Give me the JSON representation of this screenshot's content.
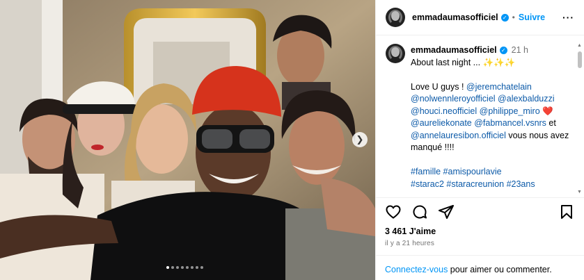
{
  "header": {
    "username": "emmadaumasofficiel",
    "verified_icon": "verified-badge-icon",
    "separator": "•",
    "follow_label": "Suivre",
    "more_icon": "more-options-icon"
  },
  "caption": {
    "username": "emmadaumasofficiel",
    "time": "21 h",
    "line1": "About last night ... ✨✨✨",
    "love_prefix": "Love U guys ! ",
    "mentions": [
      "@jeremchatelain",
      "@nolwennleroyofficiel",
      "@alexbalduzzi",
      "@houci.neofficiel",
      "@philippe_miro",
      "@aureliekonate",
      "@fabmancel.vsnrs",
      "@annelauresibon.officiel"
    ],
    "heart_emoji": "❤️",
    "et": " et ",
    "suffix": " vous nous avez manqué !!!!",
    "hashtags_line1": "#famille #amispourlavie",
    "hashtags_line2": "#starac2 #staracreunion #23ans"
  },
  "actions": {
    "like_icon": "heart-icon",
    "comment_icon": "comment-icon",
    "share_icon": "share-icon",
    "save_icon": "bookmark-icon",
    "likes_text": "3 461 J'aime",
    "posted_ago": "il y a 21 heures"
  },
  "login": {
    "link": "Connectez-vous",
    "text": " pour aimer ou commenter."
  },
  "carousel": {
    "dots": 8,
    "active_index": 0,
    "next_icon": "chevron-right-icon"
  }
}
